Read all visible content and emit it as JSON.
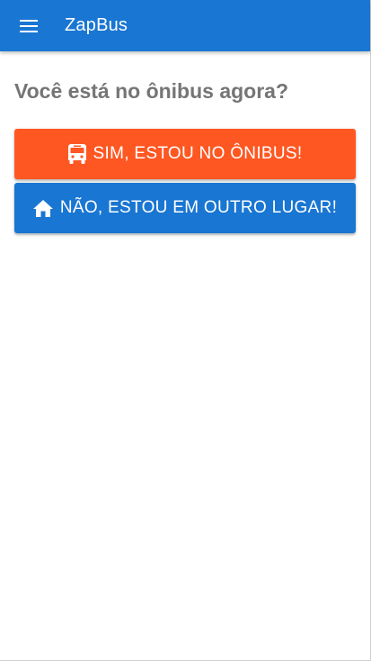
{
  "header": {
    "app_title": "ZapBus",
    "menu_icon": "menu-icon",
    "bar_color": "#1976d2"
  },
  "main": {
    "question": "Você está no ônibus agora?",
    "yes_button": {
      "label": "SIM, ESTOU NO ÔNIBUS!",
      "icon": "bus-icon",
      "color": "#ff5722"
    },
    "no_button": {
      "label": "NÃO, ESTOU EM OUTRO LUGAR!",
      "icon": "home-icon",
      "color": "#1976d2"
    }
  }
}
